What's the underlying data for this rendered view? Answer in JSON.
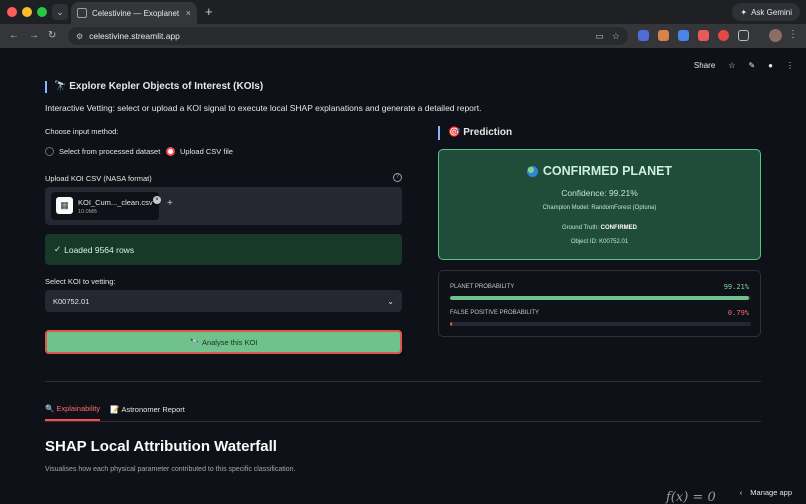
{
  "browser": {
    "tab_title": "Celestivine — Exoplanet Disco",
    "tab_close": "×",
    "new_tab": "+",
    "url": "celestivine.streamlit.app",
    "gemini_label": "Ask Gemini"
  },
  "toolbar": {
    "share_label": "Share"
  },
  "explore": {
    "heading": "🔭 Explore Kepler Objects of Interest (KOIs)",
    "intro": "Interactive Vetting: select or upload a KOI signal to execute local SHAP explanations and generate a detailed report."
  },
  "input_method": {
    "label": "Choose input method:",
    "options": [
      "Select from processed dataset",
      "Upload CSV file"
    ],
    "selected_index": 1
  },
  "upload": {
    "label": "Upload KOI CSV (NASA format)",
    "file_name": "KOI_Cum..._clean.csv",
    "file_size": "10.0MB"
  },
  "status": {
    "loaded": "Loaded 9564 rows"
  },
  "koi_select": {
    "label": "Select KOI to vetting:",
    "value": "K00752.01"
  },
  "analyse_button": {
    "label": "Analyse this KOI"
  },
  "prediction": {
    "heading": "Prediction",
    "verdict": "CONFIRMED PLANET",
    "confidence": "Confidence: 99.21%",
    "champion": "Champion Model: RandomForest (Optuna)",
    "truth_label": "Ground Truth:",
    "truth_value": "CONFIRMED",
    "object_id": "Object ID: K00752.01",
    "planet_prob_label": "PLANET PROBABILITY",
    "planet_prob_text": "99.21%",
    "planet_prob": 0.9921,
    "fp_prob_label": "FALSE POSITIVE PROBABILITY",
    "fp_prob_text": "0.79%",
    "fp_prob": 0.0079
  },
  "tabs": [
    {
      "label": "Explainability",
      "active": true
    },
    {
      "label": "Astronomer Report",
      "active": false
    }
  ],
  "shap": {
    "title": "SHAP Local Attribution Waterfall",
    "description": "Visualises how each physical parameter contributed to this specific classification.",
    "formula": "f(x) = 0"
  },
  "footer": {
    "manage_label": "Manage app"
  },
  "colors": {
    "accent_red": "#ff4b4b",
    "success_green": "#6fc28b",
    "planet_bar": "#6fc28b",
    "fp_bar": "#ff4b4b",
    "planet_prob_text": "#7ed99a",
    "fp_prob_text": "#ff6b6b"
  }
}
